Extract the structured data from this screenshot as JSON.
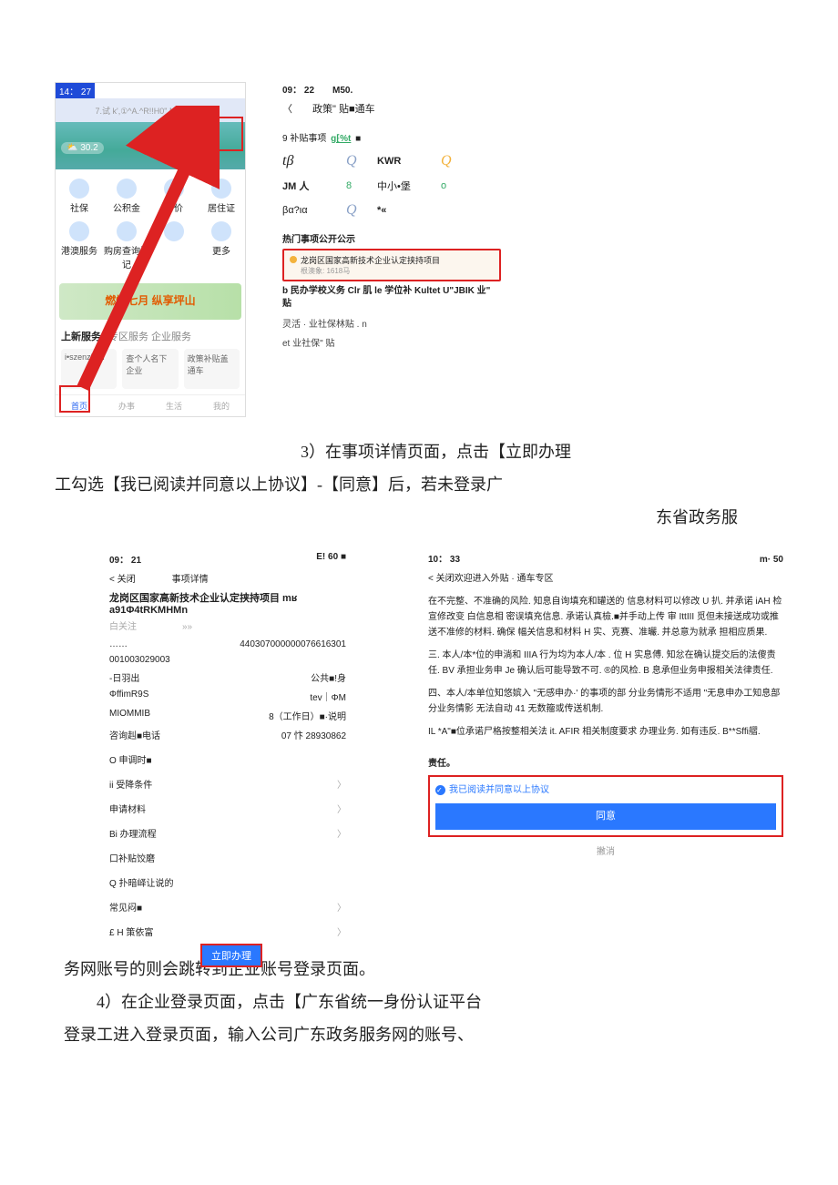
{
  "phone1": {
    "time": "14： 27",
    "search_placeholder": "7.试 k',①^A.^R!!H0\" MKWS 人",
    "weather": "⛅ 30.2",
    "grid": [
      "社保",
      "公积金",
      "房价",
      "居住证",
      "港澳服务",
      "购房查询登记",
      "",
      "更多"
    ],
    "promo": "燃情七月 纵享坪山",
    "newsec_title": "上新服务",
    "newsec_tabs": "专区服务  企业服务",
    "tiles": [
      "i•szenzhen",
      "查个人名下企业",
      "政策补贴盖通车"
    ],
    "bottom": [
      "首页",
      "办事",
      "生活",
      "我的"
    ]
  },
  "phone2": {
    "time": "09： 22　　M50.",
    "back": "〈",
    "title": "政策\" 贴■通车",
    "sec_label_a": "9 补贴事项",
    "sec_label_b": "ɡ⁅%t",
    "filters": [
      {
        "a": "tβ",
        "b": "Q",
        "c": "KWR",
        "d": "Q"
      },
      {
        "a": "JM 人",
        "b": "8",
        "c": "中小•堡",
        "d": "o"
      },
      {
        "a": "βα?ια",
        "b": "Q",
        "c": "*«",
        "d": ""
      }
    ],
    "hot": "热门事项公开公示",
    "card_title": "龙岗区国家高新技术企业认定挟持项目",
    "card_sub": "根澳象: 1618马",
    "line_b": "b 民办学校义务 Clr 肌 le 学位补 Kultet U\"JBIK 业\" 贴",
    "faint1": "灵活 · 业社保林贴 . n",
    "faint2": "et 业社保\" 贴"
  },
  "step3": {
    "l1": "3）在事项详情页面，点击【立即办理",
    "l2": "工勾选【我已阅读并同意以上协议】-【同意】后，若未登录广",
    "l3": "东省政务服"
  },
  "phone3": {
    "time_l": "09： 21",
    "time_r": "E! 60 ■",
    "bar": "< 关闭　　　　事项详情",
    "title": "龙岗区国家高新技术企业认定挟持项目 mʁ a91Φ4tRKMHMn",
    "follow": "白关注　　　　　»»",
    "kv": [
      {
        "l": "……",
        "r": "440307000000076616301"
      },
      {
        "l": "001003029003",
        "r": ""
      },
      {
        "l": "-日羽出",
        "r": "公共■!身"
      },
      {
        "l": "ΦffimR9S",
        "r": "tev｜ΦM"
      },
      {
        "l": "MIOMMIB",
        "r": "8（工作日）■·说明"
      },
      {
        "l": "咨询赳■电话",
        "r": "07 忭 28930862"
      }
    ],
    "list": [
      "O 申调时■",
      "ii 受降条件",
      "申请材料",
      "Bi 办理流程",
      "口补贴饺磨",
      "Q 扑暗峄让说的",
      "常见闷■",
      "£ H 策依富"
    ],
    "arrows": [
      "",
      "〉",
      "〉",
      "〉",
      "",
      "",
      "〉",
      "〉"
    ],
    "btn": "立即办理"
  },
  "phone4": {
    "time_l": "10： 33",
    "time_r": "m· 50",
    "bar": "< 关闭欢迎进入外贴 · 通车专区",
    "p1": "在不完整、不准确的风险. 知息自询填充和罐送的 信息材料可以修改 U 扒. 并承诺 iAH 检宣修改变 白信息相 密误填充信息. 承诺认真檢.■并手动上传 审 IttIII 觅但未接送成功或推送不准修的材料. 确保 幅关信息和材料 H 实、克赛、准曮. 并总意为就承 担相应质果.",
    "p2": "三. 本人/本*位的申淌和 IIIA 行为均为本人/本 . 位 H 实息傅. 知忿在确认提交后的法傻责任. BV 承担业务申 Je 确认后可能导致不可. ®的风检. B 息承但业务申报相关法律责任.",
    "p3": "四、本人/本单位知悠嫔入 \"无感申办·' 的事项的部 分业务情形不适用 \"无息申办工知息部分业务情影 无法自动 41 无数籀或传送机制.",
    "p4": "IL *A\"■位承诺尸格按整相关法 it. AFIR 相关制度要求 办理业务. 如有违反. B**Sffi䒁.",
    "zr": "责任。",
    "agree": "我已阅读并同意以上协议",
    "ok": "同意",
    "cancel": "撇消"
  },
  "tail": {
    "l1": "务网账号的则会跳转到企业账号登录页面。",
    "l2": "4）在企业登录页面，点击【广东省统一身份认证平台",
    "l3": "登录工进入登录页面，输入公司广东政务服务网的账号、"
  }
}
